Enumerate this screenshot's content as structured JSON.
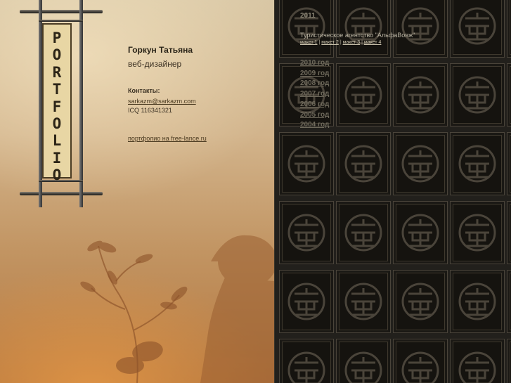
{
  "scroll": {
    "letters": [
      "P",
      "O",
      "R",
      "T",
      "F",
      "O",
      "L",
      "I",
      "O"
    ]
  },
  "profile": {
    "name": "Горкун Татьяна",
    "role": "веб-дизайнер",
    "contacts_title": "Контакты:",
    "email": "sarkazm@sarkazm.com",
    "icq": "ICQ 116341321",
    "portfolio_link": "портфолио на free-lance.ru"
  },
  "projects": {
    "current_year": "2011",
    "agency": "Туристическое агентство \"АльфаВояж\"",
    "mockups": [
      "макет 1",
      "макет 2",
      "макет 3",
      "макет 4"
    ],
    "separator": "|",
    "years": [
      "2010 год",
      "2009 год",
      "2008 год",
      "2007 год",
      "2006 год",
      "2005 год",
      "2004 год"
    ]
  },
  "colors": {
    "left_bg": "#d2b48c",
    "right_bg": "#22201c",
    "tile_fg": "#4a443a"
  }
}
